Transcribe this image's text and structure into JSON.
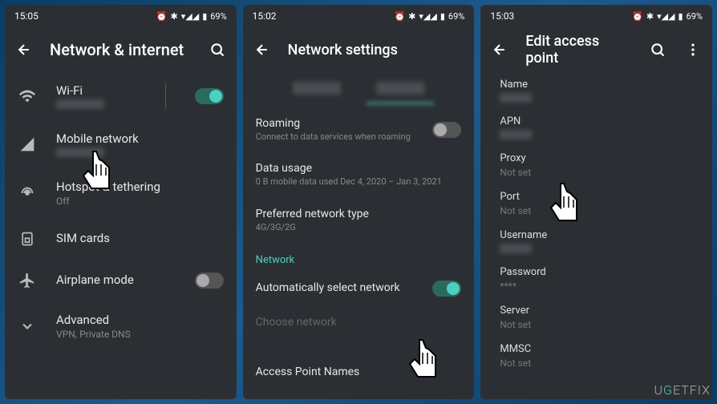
{
  "status": {
    "times": [
      "15:05",
      "15:02",
      "15:03"
    ],
    "battery": "69%",
    "icons": "⏰ ✱ ▾◢◢"
  },
  "screen1": {
    "title": "Network & internet",
    "wifi": {
      "title": "Wi-Fi"
    },
    "mobile": {
      "title": "Mobile network"
    },
    "hotspot": {
      "title": "Hotspot & tethering",
      "subtitle": "Off"
    },
    "sim": {
      "title": "SIM cards"
    },
    "airplane": {
      "title": "Airplane mode"
    },
    "advanced": {
      "title": "Advanced",
      "subtitle": "VPN, Private DNS"
    }
  },
  "screen2": {
    "title": "Network settings",
    "roaming": {
      "title": "Roaming",
      "subtitle": "Connect to data services when roaming"
    },
    "dataUsage": {
      "title": "Data usage",
      "subtitle": "0 B mobile data used Dec 4, 2020 – Jan 3, 2021"
    },
    "preferred": {
      "title": "Preferred network type",
      "subtitle": "4G/3G/2G"
    },
    "sectionNetwork": "Network",
    "autoSelect": {
      "title": "Automatically select network"
    },
    "choose": {
      "title": "Choose network"
    },
    "apn": {
      "title": "Access Point Names"
    }
  },
  "screen3": {
    "title": "Edit access point",
    "fields": {
      "name": {
        "label": "Name"
      },
      "apn": {
        "label": "APN"
      },
      "proxy": {
        "label": "Proxy",
        "value": "Not set"
      },
      "port": {
        "label": "Port",
        "value": "Not set"
      },
      "username": {
        "label": "Username"
      },
      "password": {
        "label": "Password",
        "value": "****"
      },
      "server": {
        "label": "Server",
        "value": "Not set"
      },
      "mmsc": {
        "label": "MMSC",
        "value": "Not set"
      }
    }
  },
  "watermark": "UGETFIX"
}
